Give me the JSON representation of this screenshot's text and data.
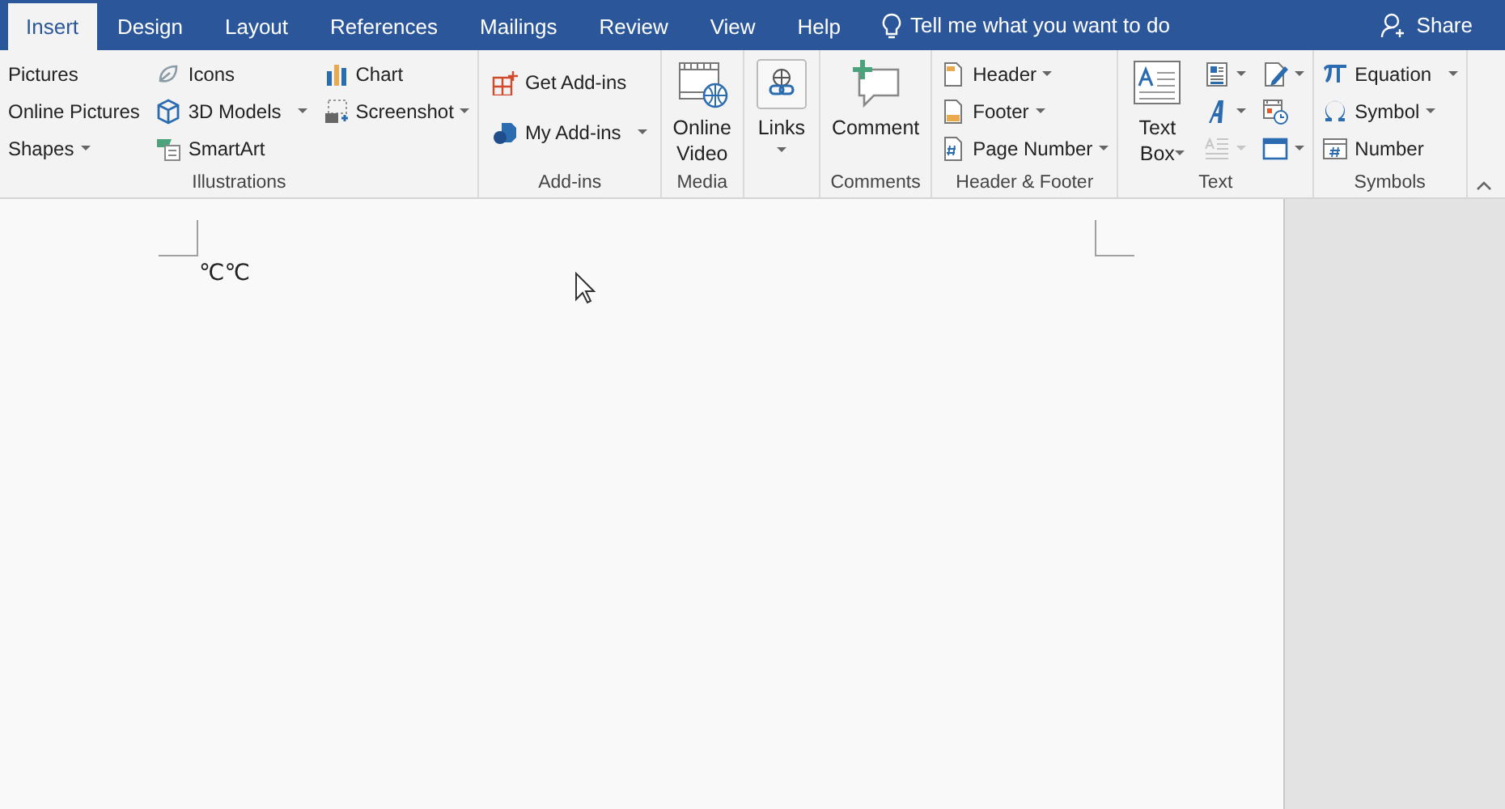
{
  "tabs": [
    {
      "label": "Insert",
      "selected": true
    },
    {
      "label": "Design",
      "selected": false
    },
    {
      "label": "Layout",
      "selected": false
    },
    {
      "label": "References",
      "selected": false
    },
    {
      "label": "Mailings",
      "selected": false
    },
    {
      "label": "Review",
      "selected": false
    },
    {
      "label": "View",
      "selected": false
    },
    {
      "label": "Help",
      "selected": false
    }
  ],
  "tell_me": {
    "placeholder": "Tell me what you want to do"
  },
  "share": {
    "label": "Share"
  },
  "groups": [
    {
      "label": "Illustrations",
      "columns": [
        [
          {
            "kind": "small",
            "label": "Pictures",
            "dropdown": false
          },
          {
            "kind": "small",
            "label": "Online Pictures",
            "dropdown": false
          },
          {
            "kind": "small",
            "label": "Shapes",
            "dropdown": true
          }
        ],
        [
          {
            "kind": "small",
            "label": "Icons",
            "dropdown": false
          },
          {
            "kind": "small",
            "label": "3D Models",
            "dropdown": true
          },
          {
            "kind": "small",
            "label": "SmartArt",
            "dropdown": false
          }
        ],
        [
          {
            "kind": "small",
            "label": "Chart",
            "dropdown": false
          },
          {
            "kind": "small",
            "label": "Screenshot",
            "dropdown": true
          }
        ]
      ]
    },
    {
      "label": "Add-ins",
      "columns": [
        [
          {
            "kind": "medium",
            "label": "Get Add-ins",
            "dropdown": false
          },
          {
            "kind": "medium",
            "label": "My Add-ins",
            "dropdown": true
          }
        ]
      ]
    },
    {
      "label": "Media",
      "columns": [
        [
          {
            "kind": "large",
            "label": "Online Video",
            "dropdown": false
          }
        ]
      ]
    },
    {
      "columns": [
        [
          {
            "kind": "large",
            "label": "Links",
            "dropdown": true
          }
        ]
      ]
    },
    {
      "label": "Comments",
      "columns": [
        [
          {
            "kind": "large",
            "label": "Comment",
            "dropdown": false
          }
        ]
      ]
    },
    {
      "label": "Header & Footer",
      "columns": [
        [
          {
            "kind": "small",
            "label": "Header",
            "dropdown": true
          },
          {
            "kind": "small",
            "label": "Footer",
            "dropdown": true
          },
          {
            "kind": "small",
            "label": "Page Number",
            "dropdown": true
          }
        ]
      ]
    },
    {
      "label": "Text",
      "columns": [
        [
          {
            "kind": "large",
            "label": "Text Box",
            "dropdown": true
          }
        ],
        [
          {
            "kind": "icon",
            "dropdown": true,
            "disabled": false
          },
          {
            "kind": "icon",
            "dropdown": true,
            "disabled": false
          },
          {
            "kind": "icon",
            "dropdown": true,
            "disabled": true
          }
        ],
        [
          {
            "kind": "icon",
            "dropdown": true,
            "disabled": false
          },
          {
            "kind": "icon",
            "dropdown": false,
            "disabled": false
          },
          {
            "kind": "icon",
            "dropdown": true,
            "disabled": false
          }
        ]
      ]
    },
    {
      "label": "Symbols",
      "columns": [
        [
          {
            "kind": "small",
            "label": "Equation",
            "dropdown": true
          },
          {
            "kind": "small",
            "label": "Symbol",
            "dropdown": true
          },
          {
            "kind": "small",
            "label": "Number",
            "dropdown": false
          }
        ]
      ]
    }
  ],
  "document": {
    "text": "℃℃"
  }
}
